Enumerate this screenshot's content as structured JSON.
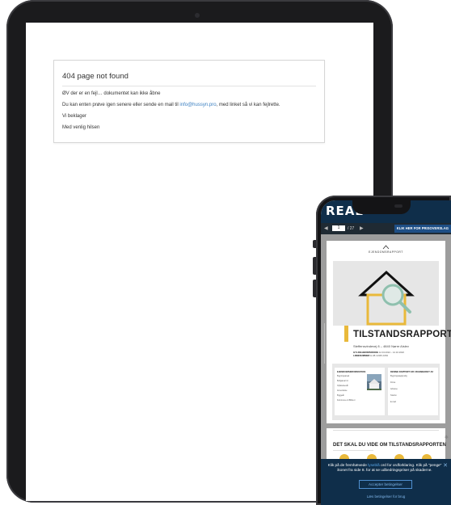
{
  "tablet": {
    "error": {
      "title": "404 page not found",
      "line1": "ØV der er en fejl… dokumentet kan ikke åbne",
      "line2_prefix": "Du kan enten prøve igen senere eller sende en mail til ",
      "line2_email": "info@hussyn.pro",
      "line2_suffix": ", med linket så vi kan fejlrette.",
      "line3": "Vi beklager",
      "line4": "Med venlig hilsen"
    }
  },
  "phone": {
    "logo": "REAL",
    "toolbar": {
      "prev_icon": "chevron-left-icon",
      "page_value": "1",
      "total": "/ 27",
      "next_icon": "chevron-right-icon",
      "cta": "KLIK HER FOR PRISOVERSLAG"
    },
    "report": {
      "brand": "EJENDOMSRAPPORT",
      "title": "TILSTANDSRAPPORT",
      "address": "Steffensvindevej 8 – 4840 Nørre Alslev",
      "meta1_label": "GYLDIGHEDSPERIODE",
      "meta1_value": "12.04.2022 – 12.10.2022",
      "meta2_label": "LØBENUMMER",
      "meta2_value": "H-08-12345-0152",
      "info_left_head": "EJENDOMSINFORMATION",
      "info_left_lines": [
        "Bygningsareal",
        "Boligareal m²",
        "Opførelsesår",
        "Anvendelse",
        "Byggeår",
        "Kommune-nr./BFE-nr."
      ],
      "info_right_head": "DENNE RAPPORT ER UDARBEJDET AF",
      "info_right_lines": [
        "Bygningssagkyndig",
        "Firma",
        "Adresse",
        "Telefon",
        "E-mail"
      ]
    },
    "page2": {
      "title": "DET SKAL DU VIDE OM TILSTANDSRAPPORTEN"
    },
    "cookie": {
      "text_a": "Klik på de fremhævede ",
      "text_hl": "lyseblå",
      "text_b": " ord for ordforklaring. Klik på \"penge\" ikonet fra side 8. for at se udbedringspriser på skaderne.",
      "accept": "Accepter betingelser",
      "read": "Læs betingelser for brug",
      "close_icon": "close-icon"
    }
  }
}
